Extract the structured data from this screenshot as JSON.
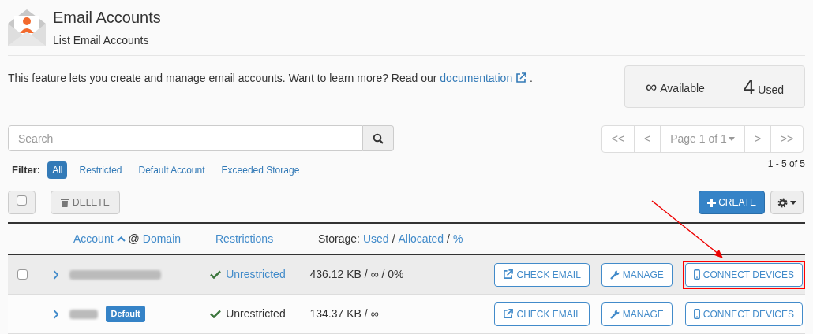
{
  "header": {
    "title": "Email Accounts",
    "subtitle": "List Email Accounts"
  },
  "intro": {
    "text": "This feature lets you create and manage email accounts. Want to learn more? Read our",
    "link": "documentation",
    "after": "."
  },
  "stats": {
    "available_value": "∞",
    "available_label": "Available",
    "used_value": "4",
    "used_label": "Used"
  },
  "search": {
    "placeholder": "Search"
  },
  "pagination": {
    "first": "<<",
    "prev": "<",
    "page": "Page 1 of 1",
    "next": ">",
    "last": ">>",
    "range": "1 - 5 of 5"
  },
  "filter": {
    "label": "Filter:",
    "options": [
      {
        "label": "All",
        "selected": true
      },
      {
        "label": "Restricted",
        "selected": false
      },
      {
        "label": "Default Account",
        "selected": false
      },
      {
        "label": "Exceeded Storage",
        "selected": false
      }
    ]
  },
  "toolbar": {
    "select_all_checked": false,
    "delete": "DELETE",
    "create": "CREATE"
  },
  "table": {
    "columns": {
      "account": "Account",
      "at": "@",
      "domain": "Domain",
      "restrictions": "Restrictions",
      "storage": "Storage:",
      "used": "Used",
      "slash1": "/",
      "allocated": "Allocated",
      "slash2": "/",
      "percent": "%"
    },
    "rows": [
      {
        "highlighted": true,
        "checkbox": {
          "checked": false
        },
        "restriction": "Unrestricted",
        "restriction_link": true,
        "storage": "436.12 KB / ∞ / 0%",
        "check_email": "CHECK EMAIL",
        "manage": "MANAGE",
        "connect": "CONNECT DEVICES",
        "annotated": true
      },
      {
        "highlighted": false,
        "default_badge": "Default",
        "restriction": "Unrestricted",
        "restriction_link": false,
        "storage": "134.37 KB / ∞",
        "check_email": "CHECK EMAIL",
        "manage": "MANAGE",
        "connect": "CONNECT DEVICES",
        "annotated": false
      }
    ]
  }
}
